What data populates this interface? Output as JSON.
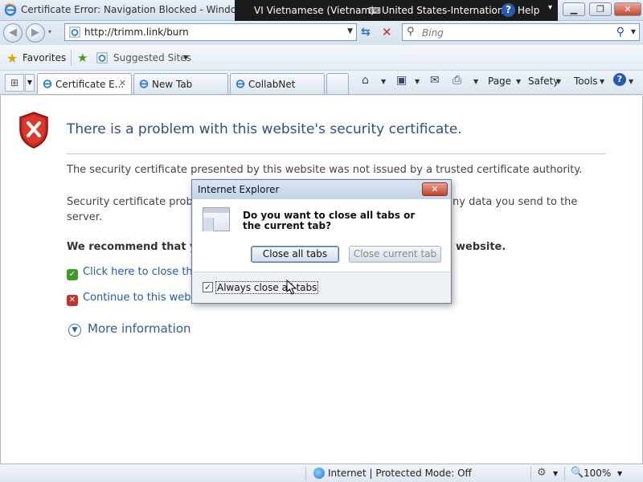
{
  "window": {
    "title": "Certificate Error: Navigation Blocked - Windows In",
    "language_bar": {
      "language": "VI Vietnamese (Vietnam)",
      "keyboard": "United States-International",
      "help": "Help"
    }
  },
  "address_bar": {
    "url": "http://trimm.link/burn",
    "search_placeholder": "Bing"
  },
  "favorites_bar": {
    "favorites_label": "Favorites",
    "suggested_sites_label": "Suggested Sites"
  },
  "tabs": [
    {
      "label": "Certificate E...",
      "active": true
    },
    {
      "label": "New Tab",
      "active": false
    },
    {
      "label": "CollabNet",
      "active": false
    }
  ],
  "command_bar": {
    "page": "Page",
    "safety": "Safety",
    "tools": "Tools"
  },
  "content": {
    "heading": "There is a problem with this website's security certificate.",
    "p1": "The security certificate presented by this website was not issued by a trusted certificate authority.",
    "p2_left": "Security certificate problem",
    "p2_right": "ny data you send to the",
    "p2_line2": "server.",
    "p3_left": "We recommend that yo",
    "p3_right": "website.",
    "link_close": "Click here to close this",
    "link_continue": "Continue to this websi",
    "more_info": "More information"
  },
  "dialog": {
    "title": "Internet Explorer",
    "message": "Do you want to close all tabs or the current tab?",
    "btn_close_all": "Close all tabs",
    "btn_close_current": "Close current tab",
    "checkbox_label": "Always close all tabs",
    "checkbox_checked": true
  },
  "status_bar": {
    "zone": "Internet | Protected Mode: Off",
    "zoom": "100%"
  }
}
